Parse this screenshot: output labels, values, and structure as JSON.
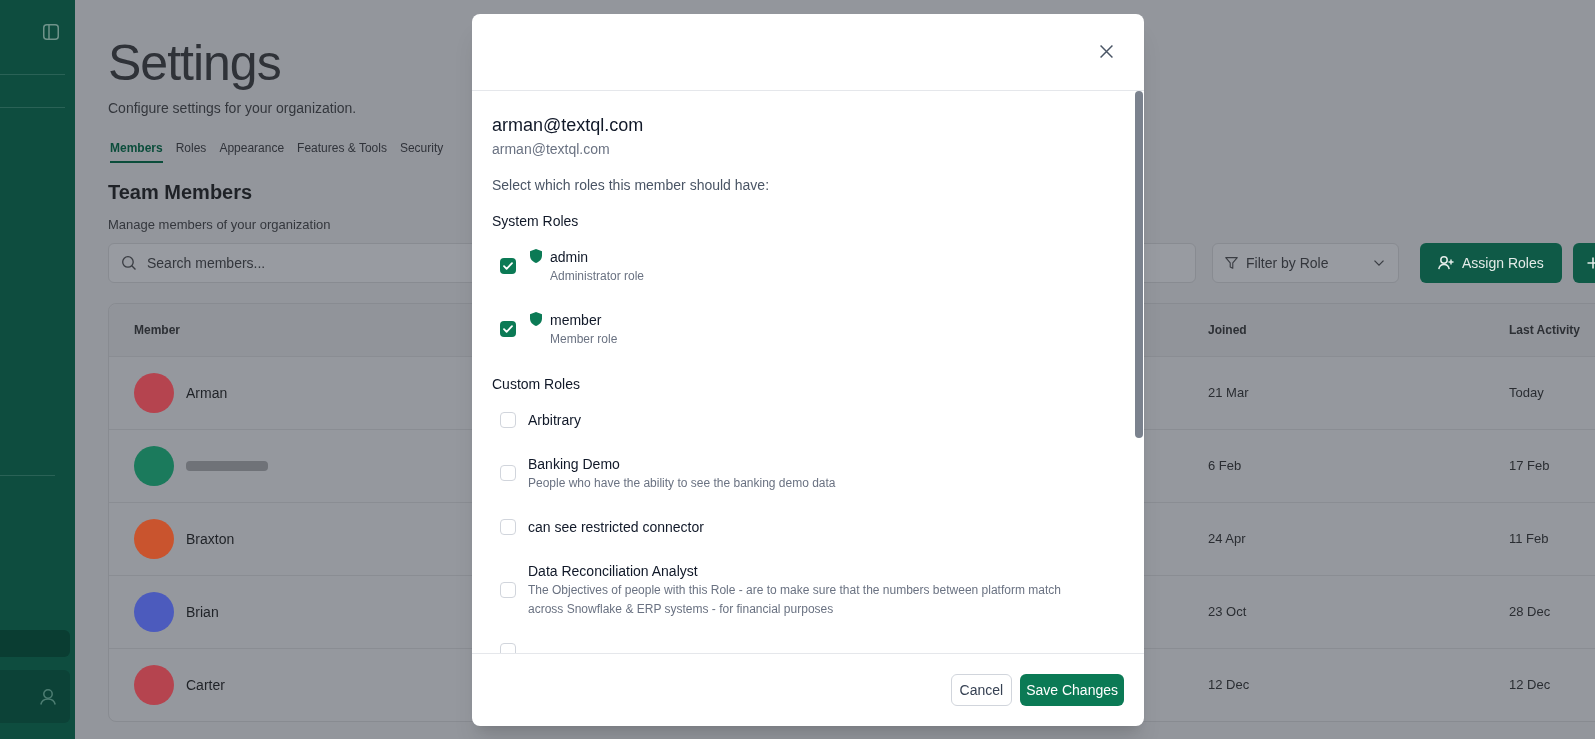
{
  "sidebar": {
    "nav_items": [
      {
        "selected": true
      }
    ]
  },
  "page": {
    "title": "Settings",
    "subtitle": "Configure settings for your organization.",
    "tabs": [
      {
        "label": "Members",
        "selected": true
      },
      {
        "label": "Roles",
        "selected": false
      },
      {
        "label": "Appearance",
        "selected": false
      },
      {
        "label": "Features & Tools",
        "selected": false
      },
      {
        "label": "Security",
        "selected": false
      }
    ],
    "section": {
      "title": "Team Members",
      "subtitle": "Manage members of your organization"
    },
    "search": {
      "placeholder": "Search members..."
    },
    "filter": {
      "placeholder": "Filter by Role"
    },
    "actions": [
      {
        "kind": "assign",
        "label": "Assign Roles"
      },
      {
        "kind": "add"
      }
    ],
    "table": {
      "columns": [
        "Member",
        "Joined",
        "Last Activity"
      ],
      "rows": [
        {
          "name": "Arman",
          "color": "#b5444f",
          "joined": "21 Mar",
          "last_activity": "Today"
        },
        {
          "color": "#1b7a5c",
          "joined": "6 Feb",
          "last_activity": "17 Feb"
        },
        {
          "name": "Braxton",
          "color": "#c9542e",
          "joined": "24 Apr",
          "last_activity": "11 Feb"
        },
        {
          "name": "Brian",
          "color": "#4c5bbd",
          "joined": "23 Oct",
          "last_activity": "28 Dec"
        },
        {
          "name": "Carter",
          "color": "#b5444f",
          "joined": "12 Dec",
          "last_activity": "12 Dec"
        }
      ]
    }
  },
  "dialog": {
    "title": "arman@textql.com",
    "subtitle": "arman@textql.com",
    "prompt": "Select which roles this member should have:",
    "groups": [
      {
        "title": "System Roles",
        "kind": "system",
        "roles": [
          {
            "name": "admin",
            "description": "Administrator role",
            "checked": true
          },
          {
            "name": "member",
            "description": "Member role",
            "checked": true
          }
        ]
      },
      {
        "title": "Custom Roles",
        "kind": "custom",
        "roles": [
          {
            "name": "Arbitrary",
            "checked": false
          },
          {
            "name": "Banking Demo",
            "description": "People who have the ability to see the banking demo data",
            "checked": false
          },
          {
            "name": "can see restricted connector",
            "checked": false
          },
          {
            "name": "Data Reconciliation Analyst",
            "description": "The Objectives of people with this Role - are to make sure that the numbers between platform match across Snowflake & ERP systems - for financial purposes",
            "checked": false
          },
          {
            "checked": false
          }
        ]
      }
    ],
    "buttons": [
      {
        "kind": "secondary",
        "label": "Cancel"
      },
      {
        "kind": "primary",
        "label": "Save Changes"
      }
    ]
  }
}
